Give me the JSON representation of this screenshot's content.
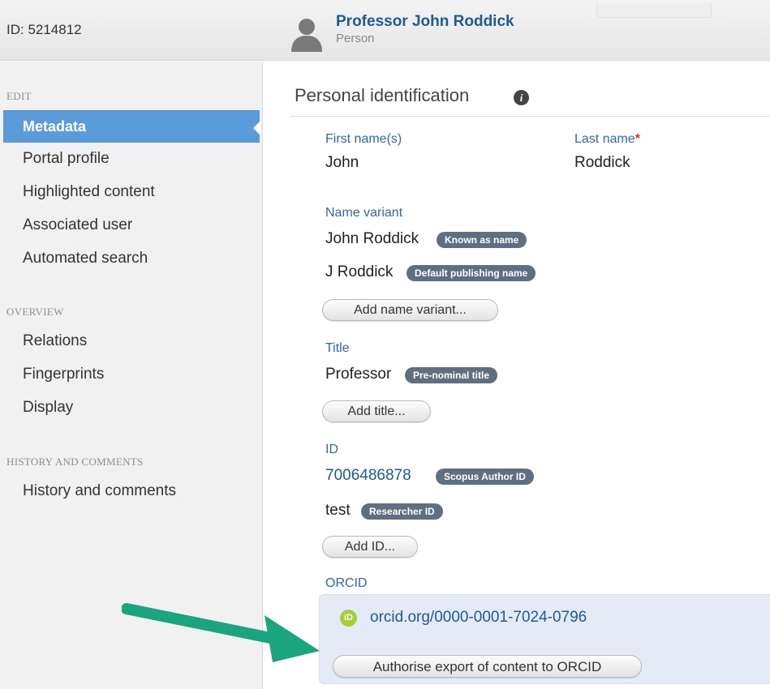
{
  "header": {
    "record_id": "ID: 5214812",
    "person_name": "Professor John Roddick",
    "person_type": "Person",
    "avatar_icon": "person-silhouette-icon"
  },
  "sidebar": {
    "edit_heading": "EDIT",
    "edit_items": [
      "Metadata",
      "Portal profile",
      "Highlighted content",
      "Associated user",
      "Automated search"
    ],
    "active_item": "Metadata",
    "overview_heading": "OVERVIEW",
    "overview_items": [
      "Relations",
      "Fingerprints",
      "Display"
    ],
    "history_heading": "HISTORY AND COMMENTS",
    "history_items": [
      "History and comments"
    ]
  },
  "main": {
    "section_title": "Personal identification",
    "info_icon": "info-icon",
    "first_name_label": "First name(s)",
    "first_name_value": "John",
    "last_name_label": "Last name",
    "required_mark": "*",
    "last_name_value": "Roddick",
    "name_variant_label": "Name variant",
    "name_variants": [
      {
        "value": "John Roddick",
        "badge": "Known as name"
      },
      {
        "value": "J Roddick",
        "badge": "Default publishing name"
      }
    ],
    "add_name_variant_label": "Add name variant...",
    "title_label": "Title",
    "title_value": "Professor",
    "title_badge": "Pre-nominal title",
    "add_title_label": "Add title...",
    "id_label": "ID",
    "ids": [
      {
        "value": "7006486878",
        "badge": "Scopus Author ID"
      },
      {
        "value": "test",
        "badge": "Researcher ID"
      }
    ],
    "add_id_label": "Add ID...",
    "orcid_label": "ORCID",
    "orcid_logo_text": "iD",
    "orcid_value": "orcid.org/0000-0001-7024-0796",
    "authorise_label": "Authorise export of content to ORCID"
  },
  "colors": {
    "accent": "#5a9bd9",
    "label_blue": "#2e6aa8",
    "badge": "#5f6f82",
    "orcid_green": "#a6ce39",
    "arrow_green": "#1aa57f"
  }
}
